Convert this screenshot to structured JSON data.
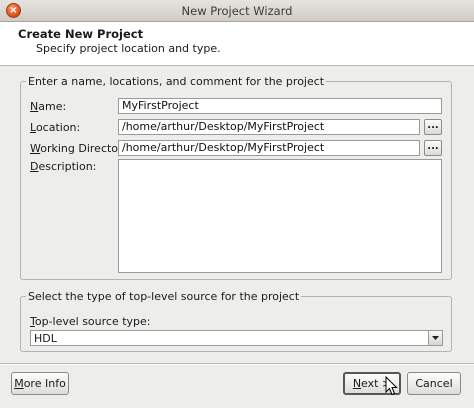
{
  "window": {
    "title": "New Project Wizard",
    "close_glyph": "×"
  },
  "header": {
    "title": "Create New Project",
    "subtitle": "Specify project location and type."
  },
  "project_group": {
    "legend": "Enter a name, locations, and comment for the project",
    "name_label_hotkey": "N",
    "name_label_rest": "ame:",
    "name_value": "MyFirstProject",
    "location_label_hotkey": "L",
    "location_label_rest": "ocation:",
    "location_value": "/home/arthur/Desktop/MyFirstProject",
    "workdir_label_hotkey": "W",
    "workdir_label_rest": "orking Directory:",
    "workdir_value": "/home/arthur/Desktop/MyFirstProject",
    "description_label_hotkey": "D",
    "description_label_rest": "escription:",
    "description_value": "",
    "browse_label": "..."
  },
  "source_group": {
    "legend": "Select the type of top-level source for the project",
    "type_label_hotkey": "T",
    "type_label_rest": "op-level source type:",
    "type_value": "HDL"
  },
  "footer": {
    "more_info_hotkey": "M",
    "more_info_rest": "ore Info",
    "next_hotkey": "N",
    "next_rest": "ext >",
    "cancel_label": "Cancel"
  },
  "icons": {
    "close": "close-icon",
    "dropdown": "chevron-down-icon",
    "cursor": "mouse-pointer-icon"
  }
}
